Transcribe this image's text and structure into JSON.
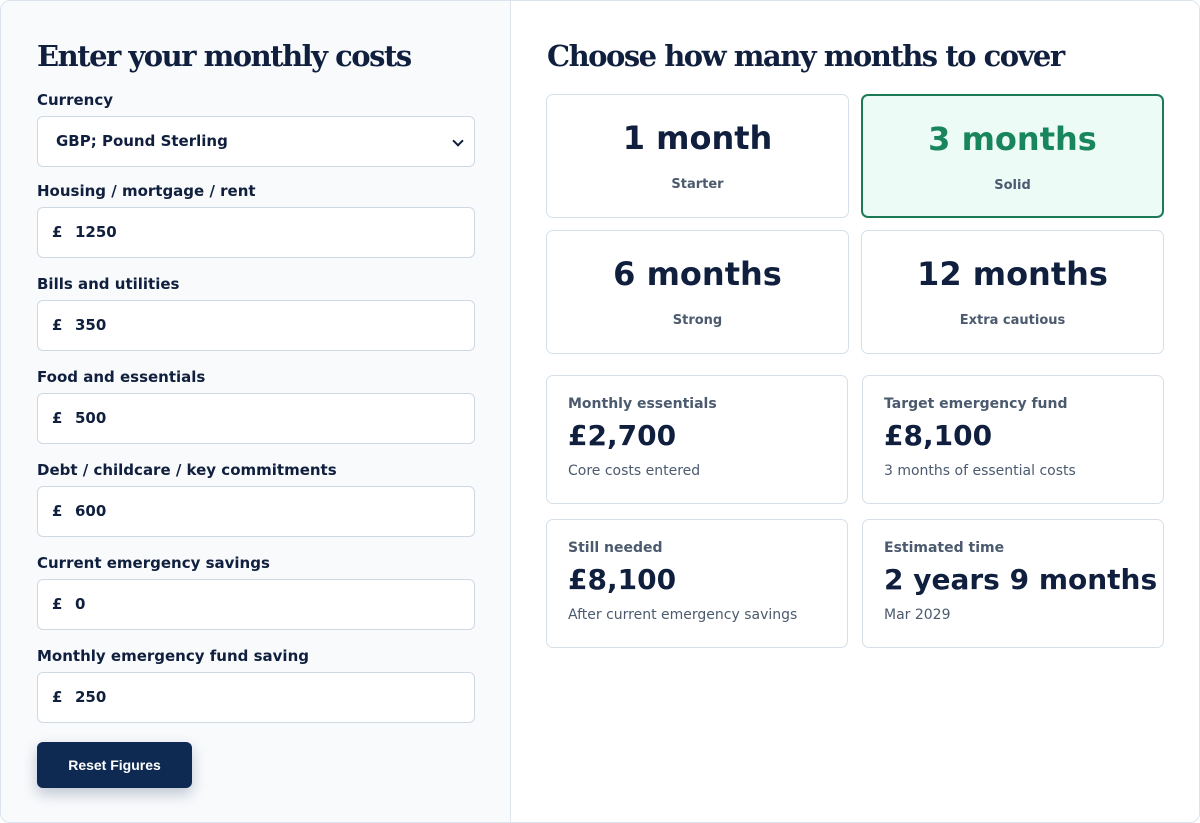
{
  "inputs_panel": {
    "title": "Enter your monthly costs",
    "currency": {
      "label": "Currency",
      "value": "GBP; Pound Sterling"
    },
    "fields": [
      {
        "label": "Housing / mortgage / rent",
        "symbol": "£",
        "value": "1250"
      },
      {
        "label": "Bills and utilities",
        "symbol": "£",
        "value": "350"
      },
      {
        "label": "Food and essentials",
        "symbol": "£",
        "value": "500"
      },
      {
        "label": "Debt / childcare / key commitments",
        "symbol": "£",
        "value": "600"
      },
      {
        "label": "Current emergency savings",
        "symbol": "£",
        "value": "0"
      },
      {
        "label": "Monthly emergency fund saving",
        "symbol": "£",
        "value": "250"
      }
    ],
    "reset_label": "Reset Figures"
  },
  "months_panel": {
    "title": "Choose how many months to cover",
    "options": [
      {
        "months": "1 month",
        "tag": "Starter",
        "selected": false
      },
      {
        "months": "3 months",
        "tag": "Solid",
        "selected": true
      },
      {
        "months": "6 months",
        "tag": "Strong",
        "selected": false
      },
      {
        "months": "12 months",
        "tag": "Extra cautious",
        "selected": false
      }
    ],
    "results": [
      {
        "label": "Monthly essentials",
        "value": "£2,700",
        "note": "Core costs entered"
      },
      {
        "label": "Target emergency fund",
        "value": "£8,100",
        "note": "3 months of essential costs"
      },
      {
        "label": "Still needed",
        "value": "£8,100",
        "note": "After current emergency savings"
      },
      {
        "label": "Estimated time",
        "value": "2 years 9 months",
        "note": "Mar 2029"
      }
    ]
  },
  "colors": {
    "navy": "#0f1f3d",
    "button": "#0f2a52",
    "accent_green": "#18855c",
    "selected_bg": "#ecfbf6",
    "muted": "#4b5a6e"
  }
}
